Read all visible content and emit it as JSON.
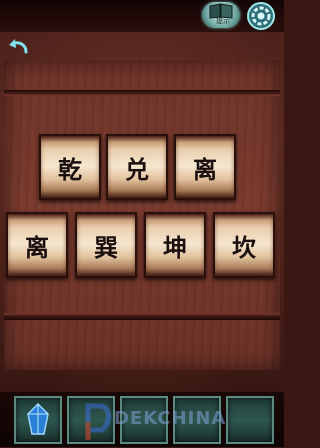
{
  "header": {
    "hint_label": "提示",
    "hint_icon": "book-icon",
    "settings_icon": "gear-icon",
    "back_icon": "back-arrow-icon"
  },
  "puzzle": {
    "row1": [
      "乾",
      "兑",
      "离"
    ],
    "row2": [
      "离",
      "巽",
      "坤",
      "坎"
    ]
  },
  "inventory": {
    "slots": [
      {
        "item": "blue-crystal-icon"
      },
      {
        "item": ""
      },
      {
        "item": ""
      },
      {
        "item": ""
      },
      {
        "item": ""
      }
    ]
  },
  "watermark": {
    "text": "DEKCHINA"
  },
  "colors": {
    "accent": "#5c8a82",
    "wood": "#7a3a2d",
    "tile": "#f6e6cf"
  }
}
